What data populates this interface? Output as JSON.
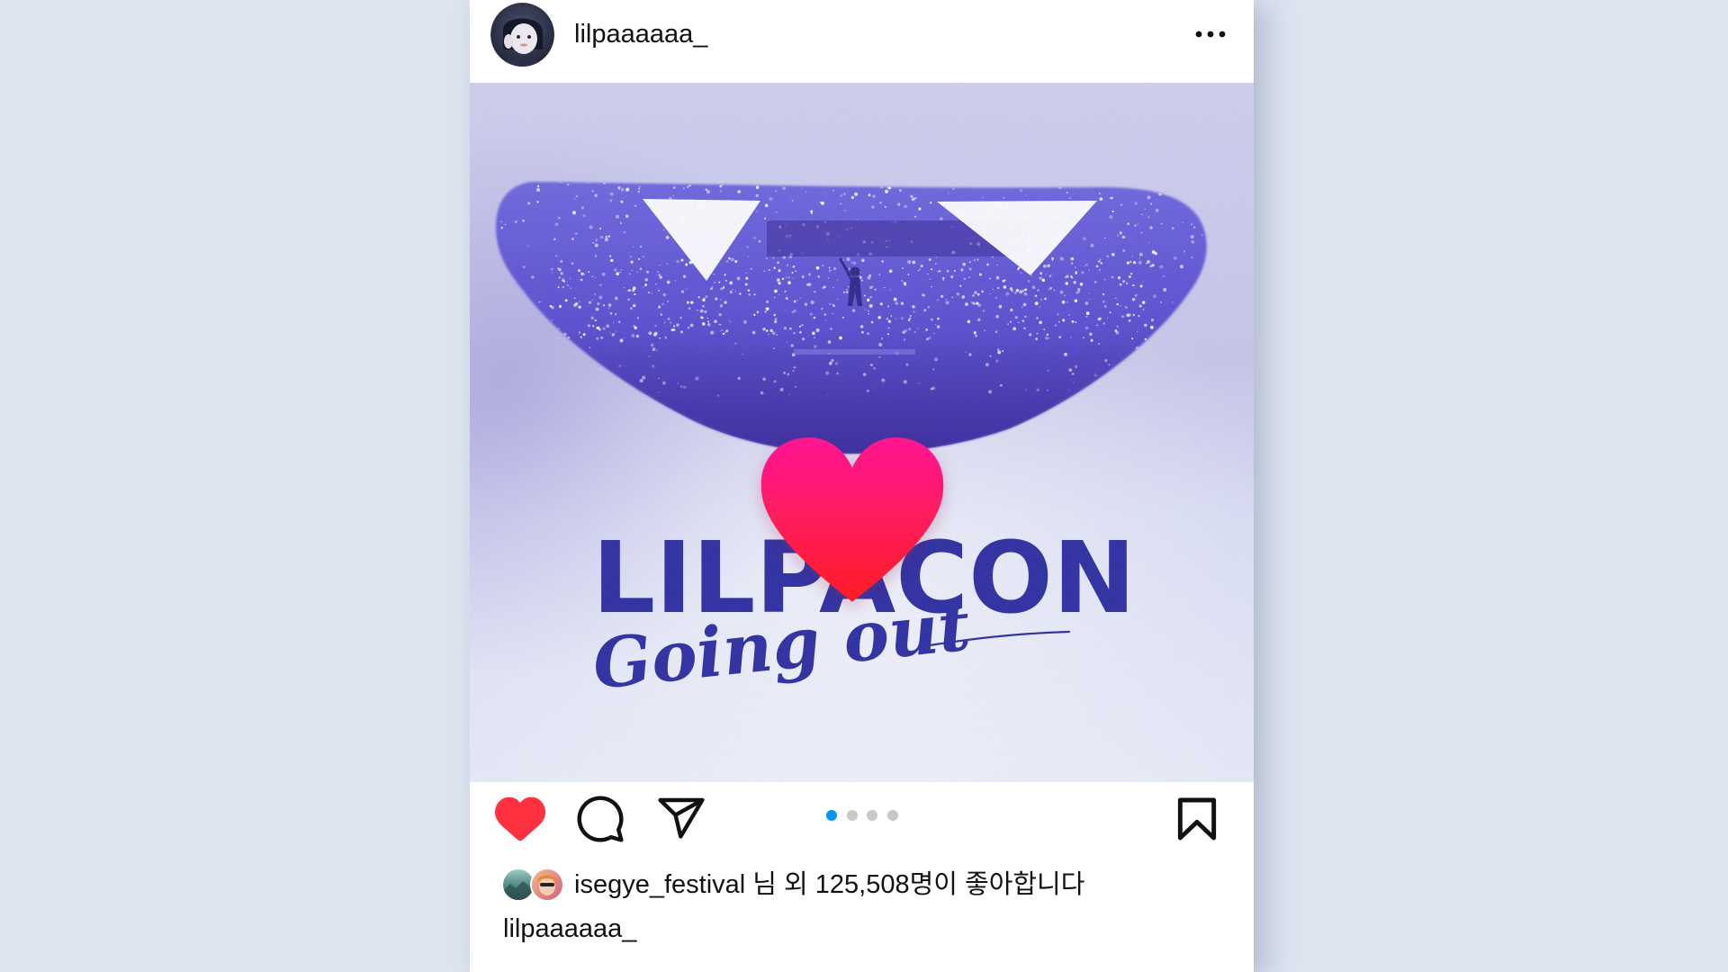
{
  "theme": {
    "page_background": "#dce4f0",
    "like_red": "#ff3040",
    "carousel_active": "#0095f6",
    "carousel_inactive": "#c8c8c8",
    "poster_blue": "#2f30a2"
  },
  "post": {
    "author": {
      "username": "lilpaaaaaa_",
      "avatar": "profile-avatar"
    },
    "header_menu_icon": "more-horizontal-icon",
    "image": {
      "headline": "LILPACON",
      "script_text": "Going out",
      "like_animation_icon": "heart-icon"
    },
    "actions": {
      "liked": true,
      "like_icon": "heart-filled-icon",
      "comment_icon": "comment-icon",
      "share_icon": "send-icon",
      "save_icon": "bookmark-icon"
    },
    "carousel": {
      "count": 4,
      "active_index": 0
    },
    "likes": {
      "username": "isegye_festival",
      "prefix": "님 외",
      "count": "125,508",
      "suffix": "명이 좋아합니다"
    },
    "caption": {
      "username": "lilpaaaaaa_"
    }
  }
}
